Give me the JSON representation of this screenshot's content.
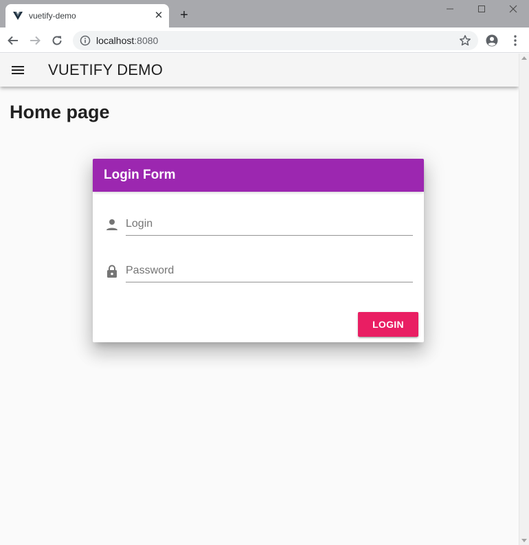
{
  "browser": {
    "tab": {
      "title": "vuetify-demo",
      "favicon": "vuetify-logo-icon",
      "close_label": "✕"
    },
    "new_tab_label": "+",
    "window_controls": [
      "minimize-icon",
      "maximize-icon",
      "close-icon"
    ],
    "address": {
      "host": "localhost",
      "port": ":8080"
    },
    "icons": [
      "back-arrow-icon",
      "forward-arrow-icon",
      "reload-icon",
      "info-icon",
      "star-icon",
      "profile-icon",
      "menu-dots-icon"
    ]
  },
  "app_bar": {
    "title": "VUETIFY DEMO",
    "menu_icon": "hamburger-menu-icon"
  },
  "page": {
    "title": "Home page"
  },
  "login_card": {
    "title": "Login Form",
    "header_color": "#9c27b0",
    "login_field": {
      "placeholder": "Login",
      "value": "",
      "icon": "person-icon"
    },
    "password_field": {
      "placeholder": "Password",
      "value": "",
      "icon": "lock-icon"
    },
    "submit_label": "LOGIN",
    "submit_color": "#e91e63"
  }
}
